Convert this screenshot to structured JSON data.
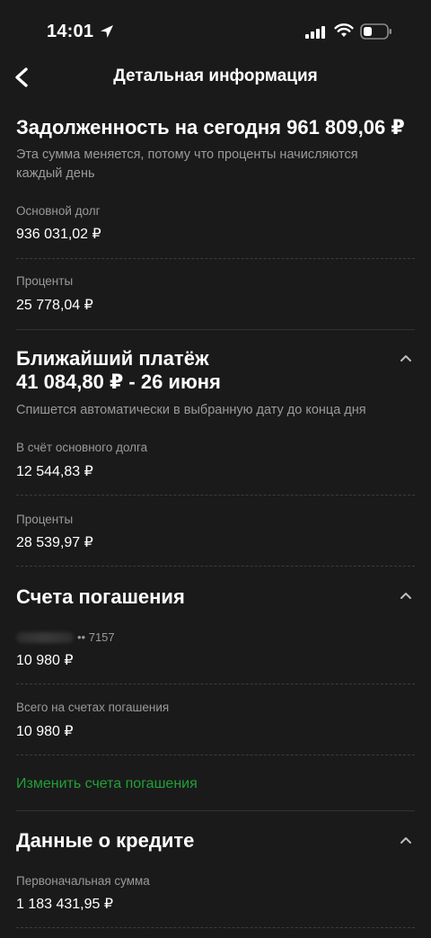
{
  "status_bar": {
    "time": "14:01"
  },
  "nav": {
    "title": "Детальная информация"
  },
  "debt": {
    "title": "Задолженность на сегодня 961 809,06 ₽",
    "hint": "Эта сумма меняется, потому что проценты начисляются каждый день",
    "principal_label": "Основной долг",
    "principal_value": "936 031,02 ₽",
    "interest_label": "Проценты",
    "interest_value": "25 778,04 ₽"
  },
  "next_payment": {
    "title_line1": "Ближайший платёж",
    "title_line2": "41 084,80 ₽ - 26 июня",
    "hint": "Спишется автоматически в выбранную дату до конца дня",
    "principal_label": "В счёт основного долга",
    "principal_value": "12 544,83 ₽",
    "interest_label": "Проценты",
    "interest_value": "28 539,97 ₽"
  },
  "repayment_accounts": {
    "title": "Счета погашения",
    "account_tail": "•• 7157",
    "account_value": "10 980 ₽",
    "total_label": "Всего на счетах погашения",
    "total_value": "10 980 ₽",
    "change_link": "Изменить счета погашения"
  },
  "credit_data": {
    "title": "Данные о кредите",
    "initial_label": "Первоначальная сумма",
    "initial_value": "1 183 431,95 ₽"
  },
  "colors": {
    "background": "#1a1a1a",
    "accent": "#21a038",
    "secondary_text": "#9a9a9a"
  }
}
